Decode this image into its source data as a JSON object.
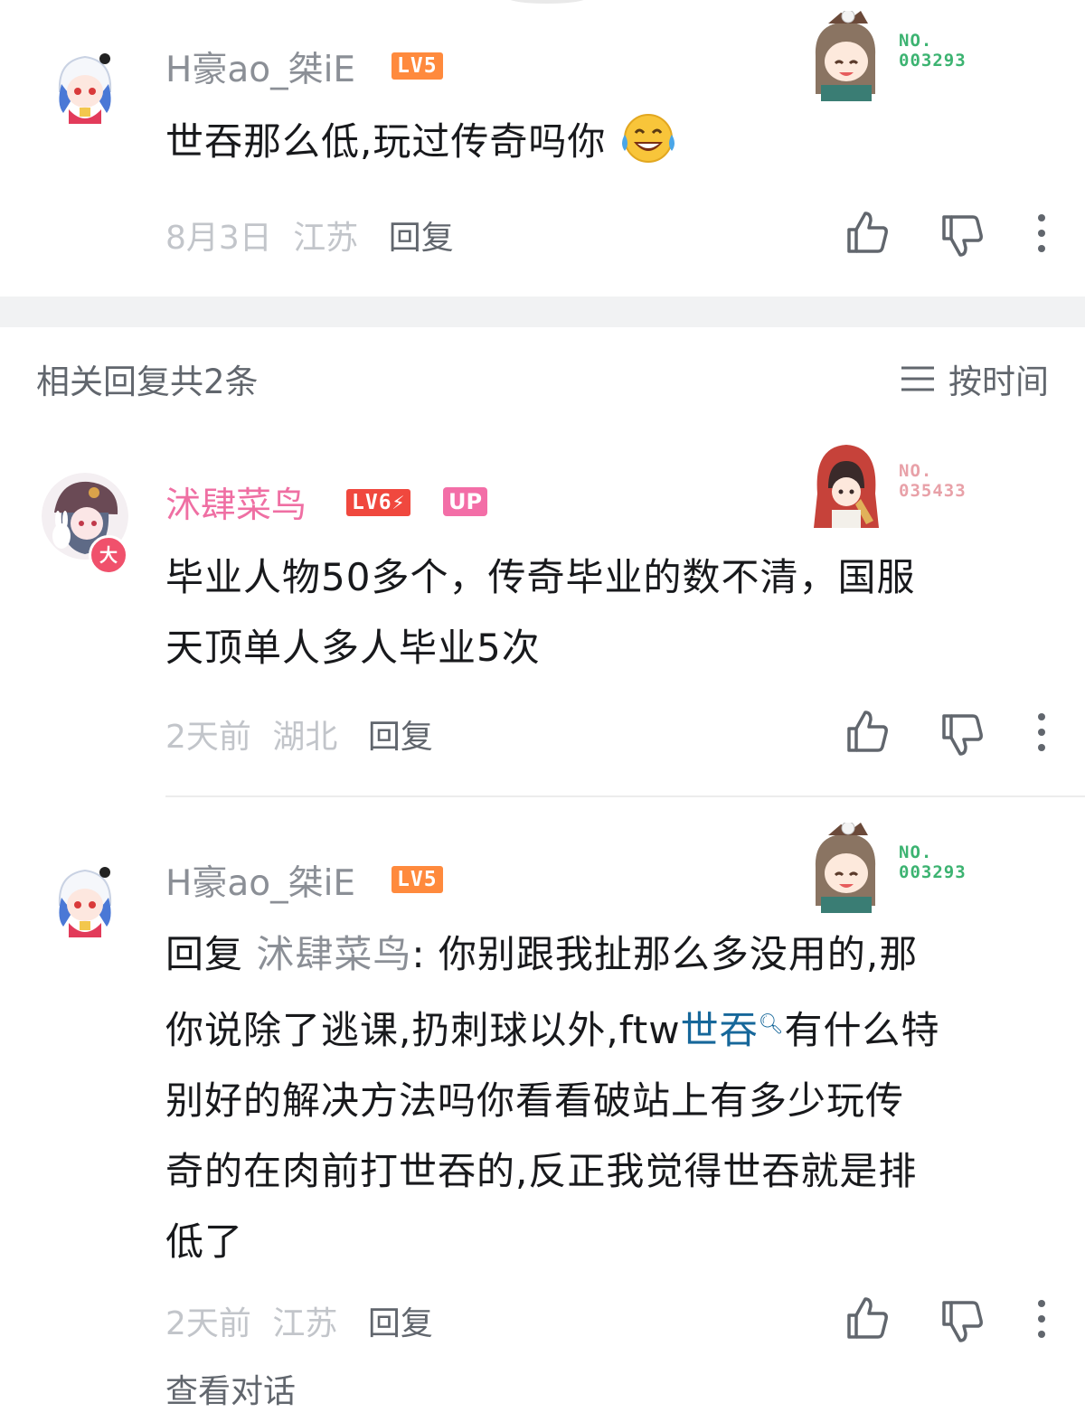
{
  "comments": [
    {
      "username": "H豪ao_桀iE",
      "level": "LV5",
      "fan_no_label": "NO.",
      "fan_no": "003293",
      "text": "世吞那么低,玩过传奇吗你",
      "emoji": "laugh-cry-emoji",
      "date": "8月3日",
      "location": "江苏",
      "reply_label": "回复"
    },
    {
      "username": "沭肆菜鸟",
      "level": "LV6",
      "up_badge": "UP",
      "avatar_badge": "大",
      "fan_no_label": "NO.",
      "fan_no": "035433",
      "text_line1": "毕业人物50多个，传奇毕业的数不清，国服",
      "text_line2": "天顶单人多人毕业5次",
      "date": "2天前",
      "location": "湖北",
      "reply_label": "回复"
    },
    {
      "username": "H豪ao_桀iE",
      "level": "LV5",
      "fan_no_label": "NO.",
      "fan_no": "003293",
      "reply_prefix": "回复",
      "reply_to": "沭肆菜鸟",
      "text_a": ": 你别跟我扯那么多没用的,那",
      "text_b": "你说除了逃课,扔刺球以外,ftw",
      "search_term": "世吞",
      "text_c": "有什么特",
      "text_d": "别好的解决方法吗你看看破站上有多少玩传",
      "text_e": "奇的在肉前打世吞的,反正我觉得世吞就是排",
      "text_f": "低了",
      "date": "2天前",
      "location": "江苏",
      "reply_label": "回复"
    }
  ],
  "section": {
    "title": "相关回复共2条",
    "sort_label": "按时间"
  },
  "bottom_text": "查看对话",
  "colors": {
    "accent_pink": "#ef6fa3",
    "link_blue": "#16679a",
    "lv5": "#ff8a3d",
    "lv6": "#f0483e",
    "up": "#f36ea7"
  }
}
